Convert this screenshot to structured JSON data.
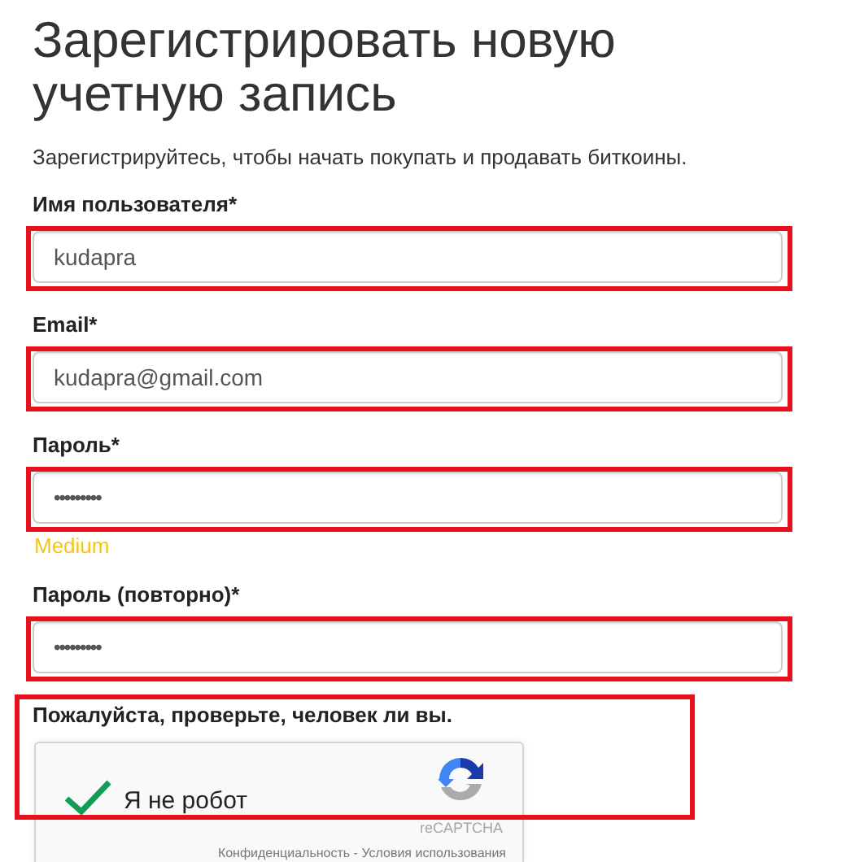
{
  "title": "Зарегистрировать новую учетную запись",
  "subtitle": "Зарегистрируйтесь, чтобы начать покупать и продавать биткоины.",
  "fields": [
    {
      "kind": "text",
      "label": "Имя пользователя*",
      "value": "kudapra",
      "highlighted": true
    },
    {
      "kind": "text",
      "label": "Email*",
      "value": "kudapra@gmail.com",
      "highlighted": true
    },
    {
      "kind": "password",
      "label": "Пароль*",
      "value": "•••••••••",
      "strength": "Medium",
      "highlighted": true
    },
    {
      "kind": "password",
      "label": "Пароль (повторно)*",
      "value": "•••••••••",
      "highlighted": true
    }
  ],
  "captcha": {
    "label": "Пожалуйста, проверьте, человек ли вы.",
    "checkbox_label": "Я не робот",
    "checked": true,
    "brand": "reCAPTCHA",
    "footer": "Конфиденциальность - Условия использования",
    "highlighted": true
  }
}
